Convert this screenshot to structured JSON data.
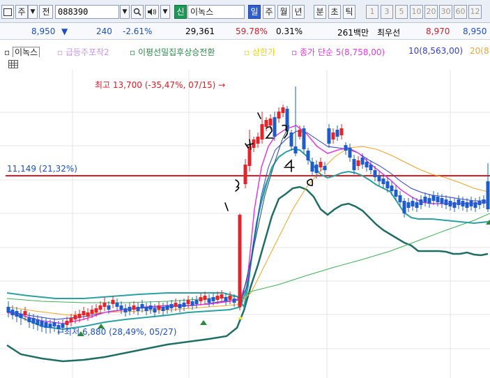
{
  "toolbar": {
    "type_label": "주",
    "prev_label": "전",
    "code_value": "088390",
    "stock_name": "이녹스",
    "new_label": "신",
    "periods": [
      "일",
      "주",
      "월",
      "년",
      "분",
      "초",
      "틱"
    ],
    "intervals": [
      "1",
      "3",
      "5",
      "10",
      "20",
      "30",
      "60",
      "12"
    ]
  },
  "quote": {
    "price": "8,950",
    "direction_arrow": "▼",
    "change": "240",
    "change_pct": "-2.61%",
    "volume": "29,361",
    "ratio": "59.78%",
    "turnover": "0.31%",
    "amount": "261백만",
    "best_ask_label": "최우선",
    "best_ask": "8,970",
    "best_bid": "8,950"
  },
  "legend": {
    "name": "이녹스",
    "item1": "급등주포착2",
    "item2": "이평선밀집후상승전환",
    "item3": "상한가",
    "item4": "종가 단순 5(8,758,00)",
    "item5": "10(8,563,00)",
    "item6": "20(8"
  },
  "annotations": {
    "high": "최고 13,700 (-35,47%, 07/15) →",
    "low": "←최저 6,880 (28,49%, 05/27)",
    "level": "11,149 (21,32%)"
  },
  "colors": {
    "up": "#e0262b",
    "down": "#1d5cc9",
    "ma5": "#e23be0",
    "ma10": "#2f3fcb",
    "ma20": "#f0a52a",
    "bb_upper": "#2aa0a0",
    "bb_lower": "#1f6e66",
    "ma60": "#3cb15a",
    "level_line": "#e01b22"
  }
}
